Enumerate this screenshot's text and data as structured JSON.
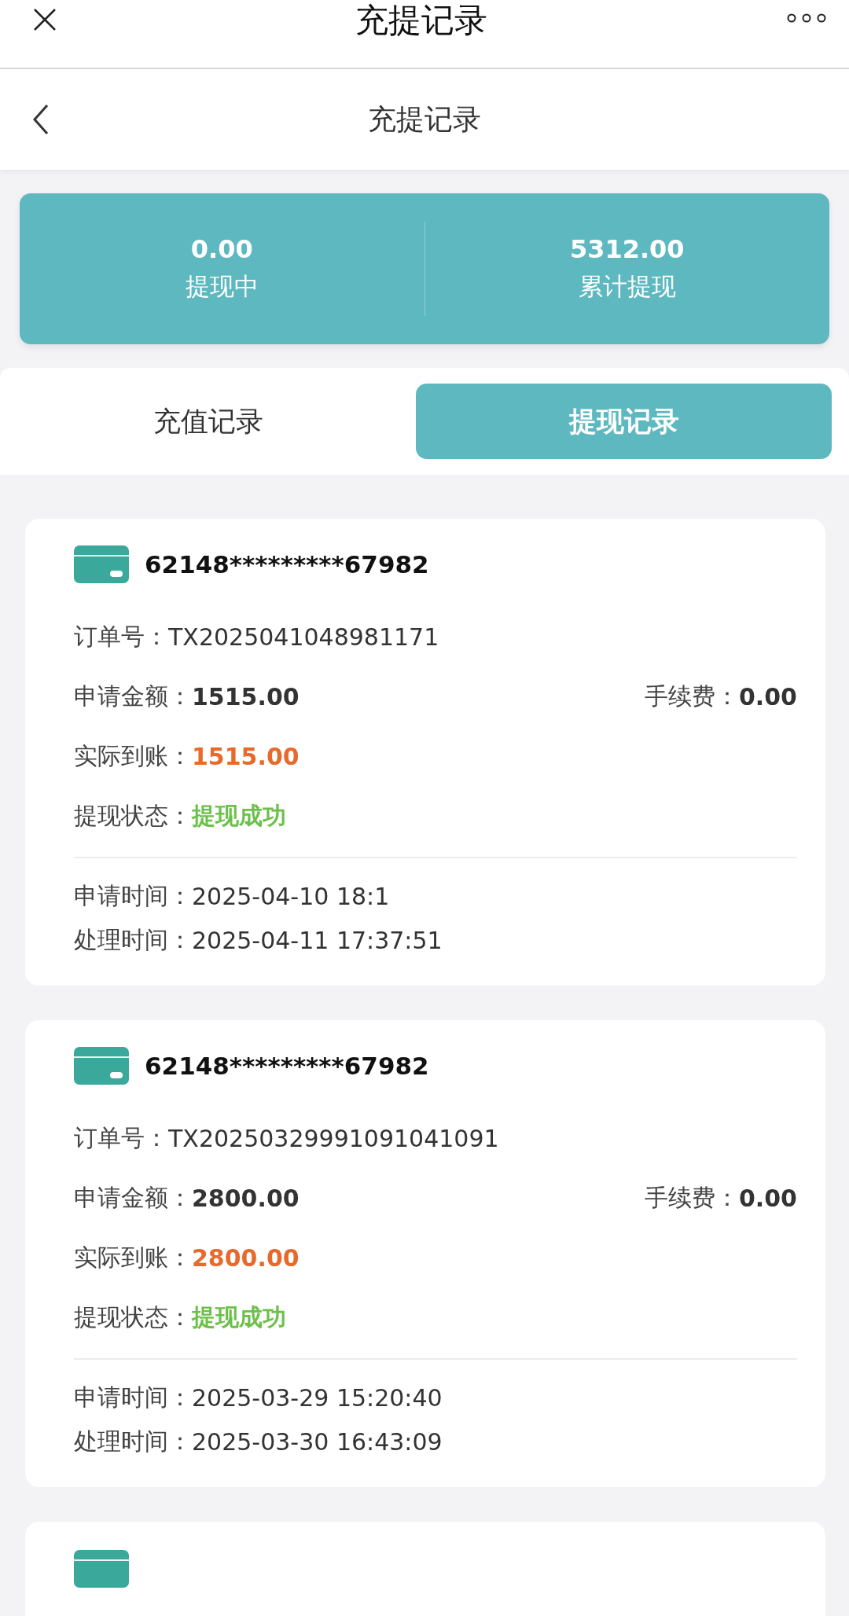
{
  "top_bar": {
    "title": "充提记录"
  },
  "nav": {
    "title": "充提记录"
  },
  "summary": [
    {
      "value": "0.00",
      "label": "提现中"
    },
    {
      "value": "5312.00",
      "label": "累计提现"
    }
  ],
  "tabs": [
    {
      "label": "充值记录",
      "selected": false
    },
    {
      "label": "提现记录",
      "selected": true
    }
  ],
  "records": [
    {
      "kind": "full",
      "card": "62148*********67982",
      "order_label": "订单号：",
      "order": "TX2025041048981171",
      "amount_label": "申请金额：",
      "amount": "1515.00",
      "fee_label": "手续费：",
      "fee": "0.00",
      "received_label": "实际到账：",
      "received": "1515.00",
      "status_label": "提现状态：",
      "status": "提现成功",
      "status_ok": true,
      "apply_label": "申请时间：",
      "apply_time": "2025-04-10 18:1",
      "process_label": "处理时间：",
      "process_time": "2025-04-11 17:37:51"
    },
    {
      "kind": "full",
      "card": "62148*********67982",
      "order_label": "订单号：",
      "order": "TX20250329991091041091",
      "amount_label": "申请金额：",
      "amount": "2800.00",
      "fee_label": "手续费：",
      "fee": "0.00",
      "received_label": "实际到账：",
      "received": "2800.00",
      "status_label": "提现状态：",
      "status": "提现成功",
      "status_ok": true,
      "apply_label": "申请时间：",
      "apply_time": "2025-03-29 15:20:40",
      "process_label": "处理时间：",
      "process_time": "2025-03-30 16:43:09"
    },
    {
      "kind": "partial"
    }
  ]
}
